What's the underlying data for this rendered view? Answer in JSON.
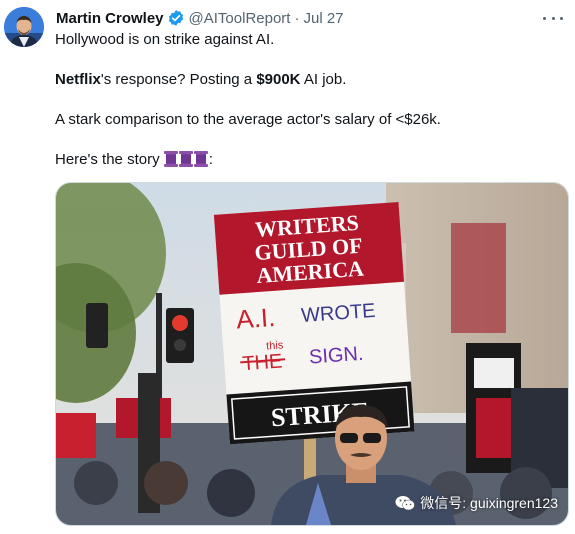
{
  "tweet": {
    "author_name": "Martin Crowley",
    "handle": "@AIToolReport",
    "separator": "·",
    "date": "Jul 27",
    "lines": {
      "line1": "Hollywood is on strike against AI.",
      "line2_bold1": "Netflix",
      "line2_mid": "'s response? Posting a ",
      "line2_bold2": "$900K",
      "line2_end": " AI job.",
      "line3": "A stark comparison to the average actor's salary of <$26k.",
      "line4": "Here's the story",
      "line4_end": ":"
    }
  },
  "image": {
    "sign_header": [
      "WRITERS",
      "GUILD OF",
      "AMERICA"
    ],
    "sign_ai": "A.I.",
    "sign_wrote": "WROTE",
    "sign_the": "THE",
    "sign_this": "this",
    "sign_sign": "SIGN.",
    "sign_strike": "STRIKE",
    "watermark": "微信号: guixingren123"
  },
  "colors": {
    "brand_blue": "#1d9bf0",
    "text": "#0f1419",
    "muted": "#536471",
    "sign_red": "#b3172b"
  },
  "icons": [
    "verified-badge-icon",
    "more-icon",
    "spool-icon",
    "wechat-icon"
  ]
}
